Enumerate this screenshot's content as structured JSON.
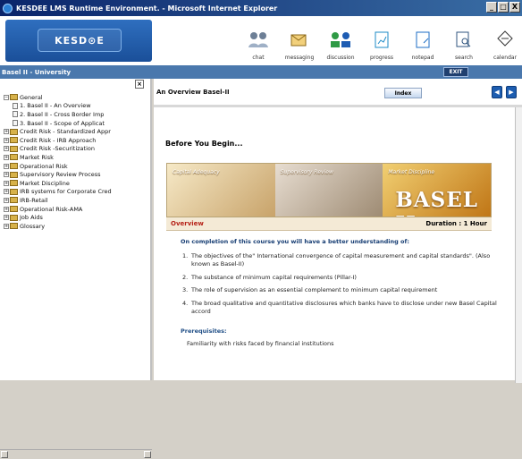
{
  "window": {
    "title": "KESDEE LMS Runtime Environment. - Microsoft Internet Explorer",
    "buttons": [
      "_",
      "□",
      "X"
    ]
  },
  "brand": {
    "logo_text": "KESD⊙E"
  },
  "toolbar": {
    "items": [
      {
        "label": "chat",
        "icon": "chat-icon"
      },
      {
        "label": "messaging",
        "icon": "messaging-icon"
      },
      {
        "label": "discussion",
        "icon": "discussion-icon"
      },
      {
        "label": "progress",
        "icon": "progress-icon"
      },
      {
        "label": "notepad",
        "icon": "notepad-icon"
      },
      {
        "label": "search",
        "icon": "search-icon"
      },
      {
        "label": "calendar",
        "icon": "calendar-icon"
      }
    ]
  },
  "subbar": {
    "section_title": "Basel II - University",
    "exit_label": "EXIT"
  },
  "left_pane": {
    "collapse_label": "×",
    "tree": [
      {
        "type": "root",
        "label": "General",
        "expanded": true
      },
      {
        "type": "doc",
        "label": "1. Basel II - An Overview"
      },
      {
        "type": "doc",
        "label": "2. Basel II - Cross Border Imp"
      },
      {
        "type": "doc",
        "label": "3. Basel II - Scope of Applicat"
      },
      {
        "type": "folder",
        "label": "Credit Risk - Standardized Appr"
      },
      {
        "type": "folder",
        "label": "Credit Risk - IRB Approach"
      },
      {
        "type": "folder",
        "label": "Credit Risk -Securitization"
      },
      {
        "type": "folder",
        "label": "Market Risk"
      },
      {
        "type": "folder",
        "label": "Operational Risk"
      },
      {
        "type": "folder",
        "label": "Supervisory Review Process"
      },
      {
        "type": "folder",
        "label": "Market Discipline"
      },
      {
        "type": "folder",
        "label": "IRB systems for Corporate Cred"
      },
      {
        "type": "folder",
        "label": "IRB-Retail"
      },
      {
        "type": "folder",
        "label": "Operational Risk-AMA"
      },
      {
        "type": "folder",
        "label": "Job Aids"
      },
      {
        "type": "folder",
        "label": "Glossary"
      }
    ]
  },
  "main": {
    "title": "An Overview Basel-II",
    "index_label": "Index",
    "nav": {
      "prev": "◀",
      "next": "▶"
    },
    "before_heading": "Before You Begin...",
    "banner": {
      "panels": [
        "Capital Adequacy",
        "Supervisory Review",
        "Market Discipline"
      ],
      "headline": "BASEL II"
    },
    "overview": {
      "label": "Overview",
      "duration_label": "Duration :",
      "duration_value": "1 Hour"
    },
    "learn_heading": "On completion of this course you will have a better understanding of:",
    "objectives": [
      "The objectives of the\" International convergence of capital measurement and capital standards\". (Also known as Basel-II)",
      "The substance of minimum capital requirements (Pillar-I)",
      "The role of supervision as an essential complement to minimum capital requirement",
      "The broad qualitative and quantitative disclosures which banks have to disclose under new Basel Capital accord"
    ],
    "prerequisites_heading": "Prerequisites:",
    "prerequisites_text": "Familiarity with risks faced by financial institutions"
  }
}
